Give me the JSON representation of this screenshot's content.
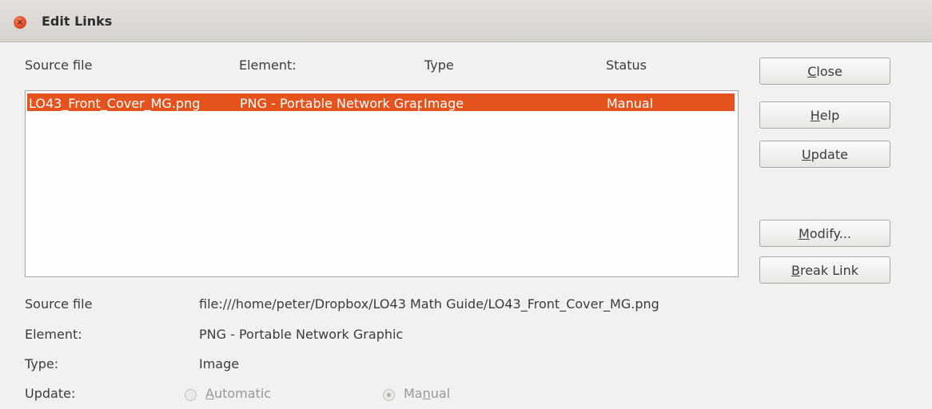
{
  "window": {
    "title": "Edit Links"
  },
  "headers": {
    "source_file": "Source file",
    "element": "Element:",
    "type": "Type",
    "status": "Status"
  },
  "links": [
    {
      "source_file": "LO43_Front_Cover_MG.png",
      "element": "PNG - Portable Network Graphic",
      "type": "Image",
      "status": "Manual",
      "selected": true
    }
  ],
  "buttons": {
    "close": {
      "pre": "",
      "key": "C",
      "post": "lose"
    },
    "help": {
      "pre": "",
      "key": "H",
      "post": "elp"
    },
    "update": {
      "pre": "",
      "key": "U",
      "post": "pdate"
    },
    "modify": {
      "pre": "",
      "key": "M",
      "post": "odify..."
    },
    "break_link": {
      "pre": "",
      "key": "B",
      "post": "reak Link"
    }
  },
  "details": {
    "source_file_label": "Source file",
    "source_file_value": "file:///home/peter/Dropbox/LO43 Math Guide/LO43_Front_Cover_MG.png",
    "element_label": "Element:",
    "element_value": "PNG - Portable Network Graphic",
    "type_label": "Type:",
    "type_value": "Image",
    "update_label": "Update:"
  },
  "update_mode": {
    "automatic": {
      "pre": "",
      "key": "A",
      "post": "utomatic",
      "checked": false
    },
    "manual": {
      "pre": "Ma",
      "key": "n",
      "post": "ual",
      "checked": true
    }
  }
}
